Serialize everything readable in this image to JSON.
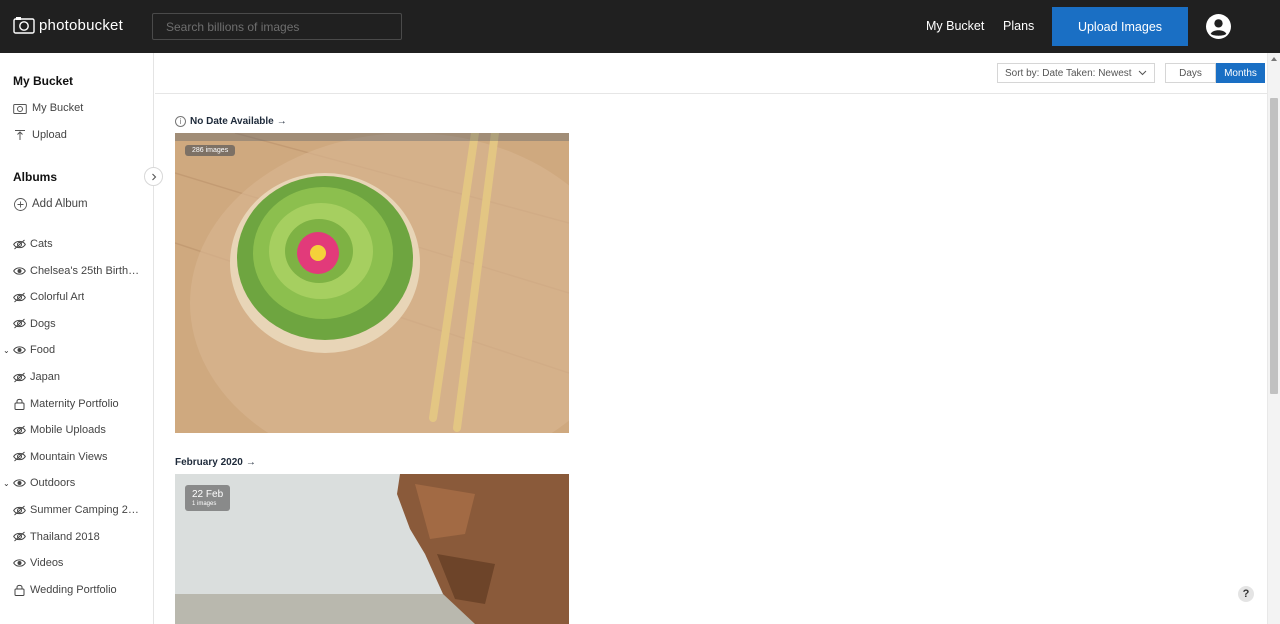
{
  "header": {
    "logo_text": "photobucket",
    "search_placeholder": "Search billions of images",
    "nav": {
      "my_bucket": "My Bucket",
      "plans": "Plans"
    },
    "upload_label": "Upload Images",
    "avatar_icon": "user-circle-icon"
  },
  "sidebar": {
    "my_bucket_heading": "My Bucket",
    "my_bucket_link": "My Bucket",
    "upload_link": "Upload",
    "albums_heading": "Albums",
    "add_album": "Add Album",
    "albums": [
      {
        "label": "Cats",
        "icon": "eye-slash-icon",
        "expanded": false
      },
      {
        "label": "Chelsea's 25th Birthday",
        "icon": "eye-icon",
        "expanded": false
      },
      {
        "label": "Colorful Art",
        "icon": "eye-slash-icon",
        "expanded": false
      },
      {
        "label": "Dogs",
        "icon": "eye-slash-icon",
        "expanded": false
      },
      {
        "label": "Food",
        "icon": "eye-icon",
        "expanded": true
      },
      {
        "label": "Japan",
        "icon": "eye-slash-icon",
        "expanded": false
      },
      {
        "label": "Maternity Portfolio",
        "icon": "lock-icon",
        "expanded": false
      },
      {
        "label": "Mobile Uploads",
        "icon": "eye-slash-icon",
        "expanded": false
      },
      {
        "label": "Mountain Views",
        "icon": "eye-slash-icon",
        "expanded": false
      },
      {
        "label": "Outdoors",
        "icon": "eye-icon",
        "expanded": true
      },
      {
        "label": "Summer Camping 2019",
        "icon": "eye-slash-icon",
        "expanded": false
      },
      {
        "label": "Thailand 2018",
        "icon": "eye-slash-icon",
        "expanded": false
      },
      {
        "label": "Videos",
        "icon": "eye-icon",
        "expanded": false
      },
      {
        "label": "Wedding Portfolio",
        "icon": "lock-icon",
        "expanded": false
      }
    ]
  },
  "toolbar": {
    "sort_label": "Sort by: Date Taken: Newest",
    "days_label": "Days",
    "months_label": "Months",
    "active_view": "Months"
  },
  "groups": [
    {
      "title": "No Date Available",
      "badge": "286 images"
    },
    {
      "title": "February 2020",
      "badge_date": "22 Feb",
      "badge_count": "1 images"
    }
  ],
  "help_label": "?",
  "colors": {
    "accent": "#1a6fc4",
    "topbar": "#202020"
  }
}
